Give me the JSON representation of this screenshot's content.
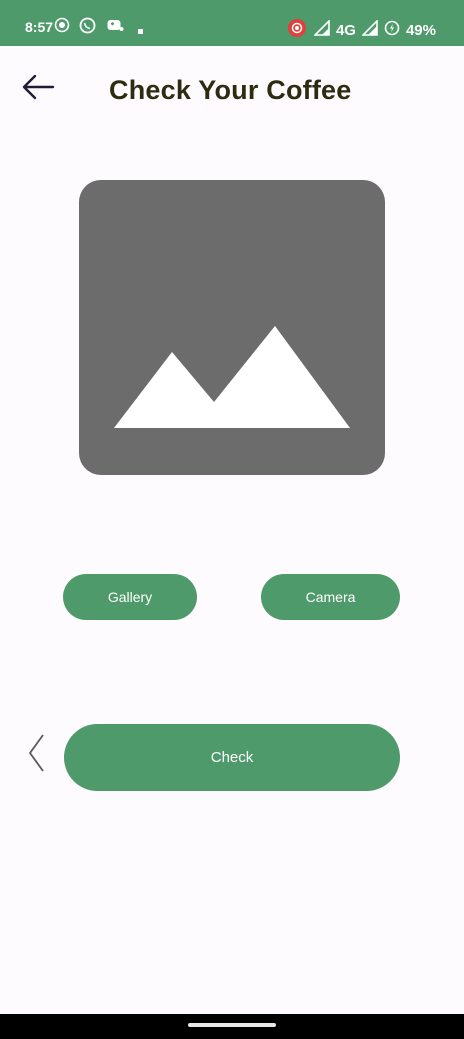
{
  "status_bar": {
    "time": "8:57",
    "network": "4G",
    "battery": "49%",
    "color": "#4e9a6a",
    "icons": [
      "screen-record-icon",
      "whatsapp-icon",
      "game-controller-icon",
      "notification-dot-icon",
      "record-icon",
      "signal-icon",
      "battery-icon"
    ]
  },
  "header": {
    "title": "Check Your Coffee",
    "back_icon": "arrow-left-icon"
  },
  "preview": {
    "icon": "image-placeholder-icon",
    "color": "#6c6c6c"
  },
  "actions": {
    "gallery_label": "Gallery",
    "camera_label": "Camera",
    "check_label": "Check",
    "accent": "#4e9a6a"
  },
  "side": {
    "prev_icon": "chevron-left-icon"
  }
}
